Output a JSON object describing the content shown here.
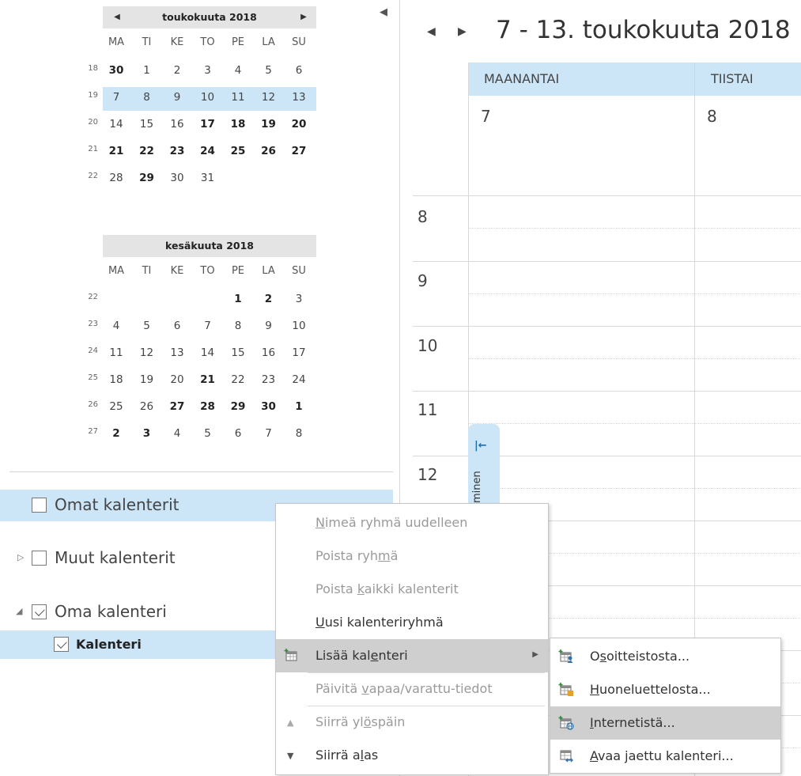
{
  "mini_calendars": [
    {
      "title": "toukokuuta 2018",
      "nav_prev": "◀",
      "nav_next": "▶",
      "weekdays": [
        "MA",
        "TI",
        "KE",
        "TO",
        "PE",
        "LA",
        "SU"
      ],
      "weeks": [
        {
          "week": "18",
          "days": [
            "30",
            "1",
            "2",
            "3",
            "4",
            "5",
            "6"
          ],
          "bold": [
            0
          ],
          "selected": false
        },
        {
          "week": "19",
          "days": [
            "7",
            "8",
            "9",
            "10",
            "11",
            "12",
            "13"
          ],
          "bold": [],
          "selected": true
        },
        {
          "week": "20",
          "days": [
            "14",
            "15",
            "16",
            "17",
            "18",
            "19",
            "20"
          ],
          "bold": [
            3,
            4,
            5,
            6
          ],
          "selected": false
        },
        {
          "week": "21",
          "days": [
            "21",
            "22",
            "23",
            "24",
            "25",
            "26",
            "27"
          ],
          "bold": [
            0,
            1,
            2,
            3,
            4,
            5,
            6
          ],
          "selected": false
        },
        {
          "week": "22",
          "days": [
            "28",
            "29",
            "30",
            "31",
            "",
            "",
            ""
          ],
          "bold": [
            1
          ],
          "selected": false
        }
      ]
    },
    {
      "title": "kesäkuuta 2018",
      "weekdays": [
        "MA",
        "TI",
        "KE",
        "TO",
        "PE",
        "LA",
        "SU"
      ],
      "weeks": [
        {
          "week": "22",
          "days": [
            "",
            "",
            "",
            "",
            "1",
            "2",
            "3"
          ],
          "bold": [
            4,
            5
          ],
          "selected": false
        },
        {
          "week": "23",
          "days": [
            "4",
            "5",
            "6",
            "7",
            "8",
            "9",
            "10"
          ],
          "bold": [],
          "selected": false
        },
        {
          "week": "24",
          "days": [
            "11",
            "12",
            "13",
            "14",
            "15",
            "16",
            "17"
          ],
          "bold": [],
          "selected": false
        },
        {
          "week": "25",
          "days": [
            "18",
            "19",
            "20",
            "21",
            "22",
            "23",
            "24"
          ],
          "bold": [
            3
          ],
          "selected": false
        },
        {
          "week": "26",
          "days": [
            "25",
            "26",
            "27",
            "28",
            "29",
            "30",
            "1"
          ],
          "bold": [
            2,
            3,
            4,
            5,
            6
          ],
          "selected": false
        },
        {
          "week": "27",
          "days": [
            "2",
            "3",
            "4",
            "5",
            "6",
            "7",
            "8"
          ],
          "bold": [
            0,
            1
          ],
          "selected": false
        }
      ]
    }
  ],
  "groups": {
    "omat": {
      "label": "Omat kalenterit",
      "checked": false
    },
    "muut": {
      "label": "Muut kalenterit",
      "checked": false
    },
    "oma": {
      "label": "Oma kalenteri",
      "checked": true
    },
    "kalenteri": {
      "label": "Kalenteri",
      "checked": true
    }
  },
  "collapse_icon": "◀",
  "calendar": {
    "nav_prev": "◀",
    "nav_next": "▶",
    "title": "7 - 13. toukokuuta 2018",
    "days": [
      {
        "name": "MAANANTAI",
        "num": "7"
      },
      {
        "name": "TIISTAI",
        "num": "8"
      }
    ],
    "hours": [
      "8",
      "9",
      "10",
      "11",
      "12"
    ],
    "peek_text": "minen",
    "peek_pin": "|←"
  },
  "context_menu": {
    "items": [
      {
        "pre": "",
        "key": "N",
        "post": "imeä ryhmä uudelleen",
        "disabled": true
      },
      {
        "pre": "Poista ryh",
        "key": "m",
        "post": "ä",
        "disabled": true
      },
      {
        "pre": "Poista ",
        "key": "k",
        "post": "aikki kalenterit",
        "disabled": true
      },
      {
        "pre": "",
        "key": "U",
        "post": "usi kalenteriryhmä",
        "disabled": false
      },
      {
        "pre": "Lisää kal",
        "key": "e",
        "post": "nteri",
        "disabled": false,
        "submenu": true
      },
      {
        "pre": "Päivitä ",
        "key": "v",
        "post": "apaa/varattu-tiedot",
        "disabled": true
      },
      {
        "pre": "Siirrä yl",
        "key": "ö",
        "post": "späin",
        "disabled": true
      },
      {
        "pre": "Siirrä a",
        "key": "l",
        "post": "as",
        "disabled": false
      }
    ]
  },
  "submenu": {
    "items": [
      {
        "pre": "O",
        "key": "s",
        "post": "oitteistosta...",
        "icon": "address-book-calendar-icon"
      },
      {
        "pre": "",
        "key": "H",
        "post": "uoneluettelosta...",
        "icon": "room-list-calendar-icon"
      },
      {
        "pre": "",
        "key": "I",
        "post": "nternetistä...",
        "icon": "internet-calendar-icon"
      },
      {
        "pre": "",
        "key": "A",
        "post": "vaa jaettu kalenteri...",
        "icon": "shared-calendar-icon"
      }
    ]
  },
  "colors": {
    "selection": "#cde6f7",
    "menu_highlight": "#cfcfcf",
    "accent": "#1a6fb3"
  }
}
